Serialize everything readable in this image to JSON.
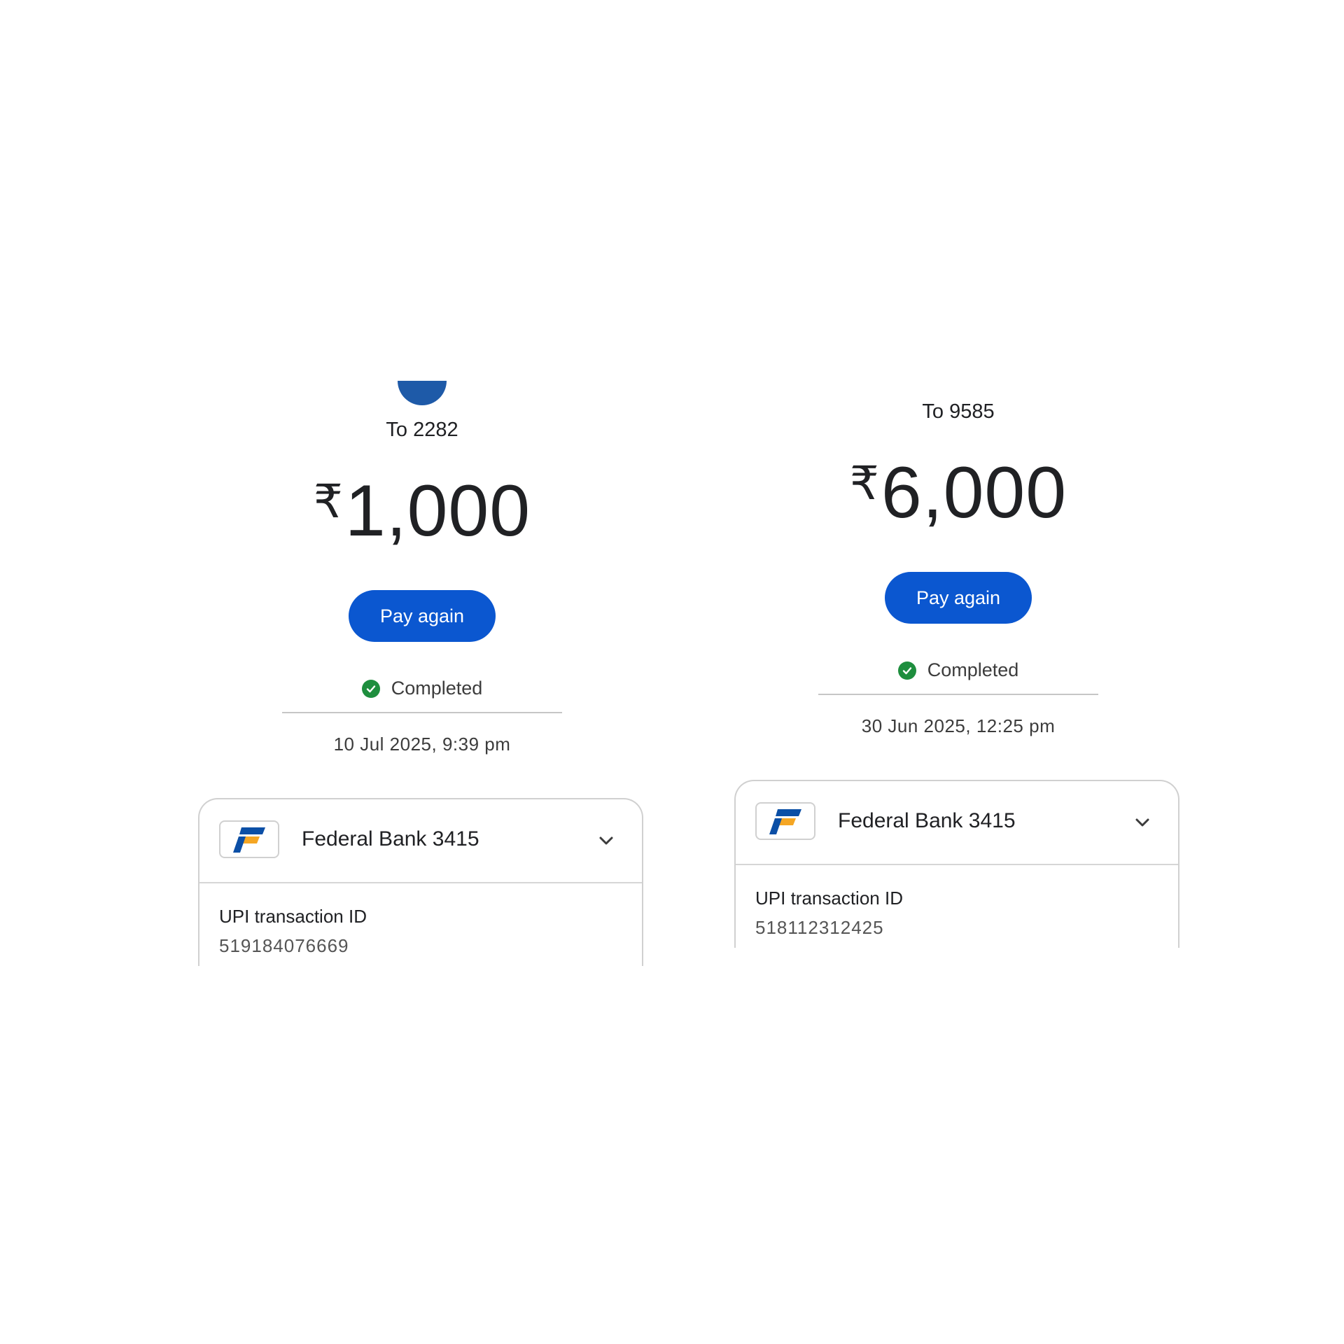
{
  "colors": {
    "primary_button": "#0b57d0",
    "success": "#1e8e3e",
    "avatar": "#1e5aa8",
    "logo_blue": "#0b4fa6",
    "logo_orange": "#f5a623"
  },
  "transactions": [
    {
      "recipient": "To 2282",
      "currency_symbol": "₹",
      "amount": "1,000",
      "button_label": "Pay again",
      "status": "Completed",
      "datetime": "10 Jul 2025, 9:39 pm",
      "bank": {
        "logo_icon": "federal-bank-logo",
        "name": "Federal Bank 3415"
      },
      "upi_label": "UPI transaction ID",
      "upi_id": "519184076669"
    },
    {
      "recipient": "To 9585",
      "currency_symbol": "₹",
      "amount": "6,000",
      "button_label": "Pay again",
      "status": "Completed",
      "datetime": "30 Jun 2025, 12:25 pm",
      "bank": {
        "logo_icon": "federal-bank-logo",
        "name": "Federal Bank 3415"
      },
      "upi_label": "UPI transaction ID",
      "upi_id": "518112312425"
    }
  ]
}
